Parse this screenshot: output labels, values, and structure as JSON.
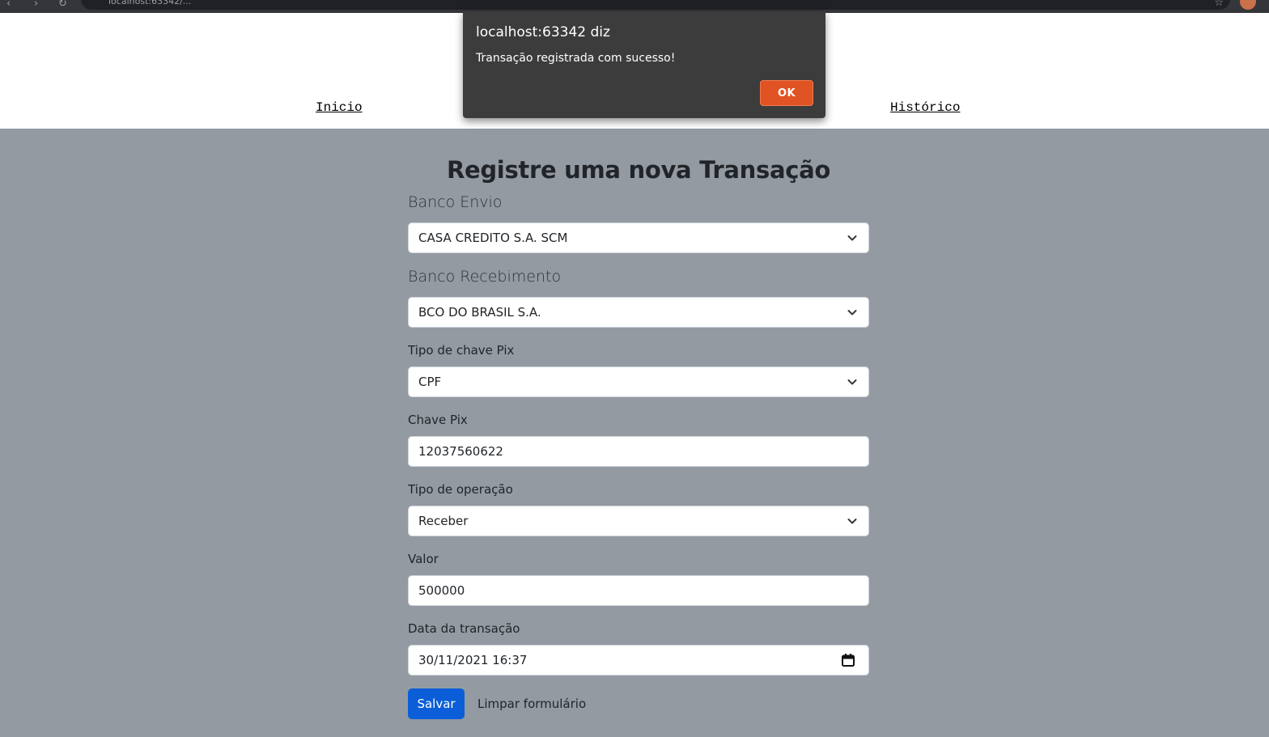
{
  "browser": {
    "url": "localhost:63342/..."
  },
  "nav": {
    "inicio": "Inicio",
    "historico": "Histórico"
  },
  "form": {
    "title": "Registre uma nova Transação",
    "banco_envio": {
      "label": "Banco Envio",
      "value": "CASA CREDITO S.A. SCM"
    },
    "banco_recebimento": {
      "label": "Banco Recebimento",
      "value": "BCO DO BRASIL S.A."
    },
    "tipo_chave": {
      "label": "Tipo de chave Pix",
      "value": "CPF"
    },
    "chave_pix": {
      "label": "Chave Pix",
      "value": "12037560622"
    },
    "tipo_operacao": {
      "label": "Tipo de operação",
      "value": "Receber"
    },
    "valor": {
      "label": "Valor",
      "value": "500000"
    },
    "data": {
      "label": "Data da transação",
      "value": "30/11/2021 16:37"
    },
    "save_label": "Salvar",
    "clear_label": "Limpar formulário"
  },
  "dialog": {
    "title": "localhost:63342 diz",
    "message": "Transação registrada com sucesso!",
    "ok_label": "OK"
  },
  "icons": {
    "chevron": "chevron-down-icon",
    "calendar": "calendar-icon"
  },
  "colors": {
    "page_bg": "#949aa2",
    "primary": "#0b5ed7",
    "dialog_bg": "#3c3c3c",
    "dialog_ok": "#e05424"
  }
}
